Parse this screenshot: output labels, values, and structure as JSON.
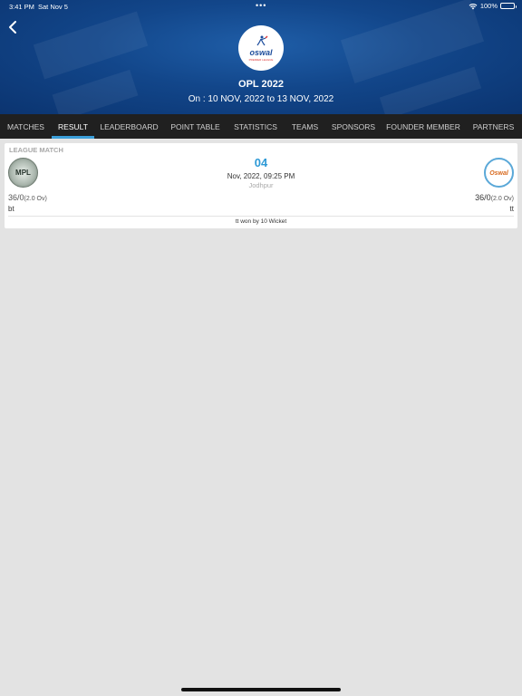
{
  "status_bar": {
    "time": "3:41 PM",
    "date": "Sat Nov 5",
    "dots": "•••",
    "battery": "100%"
  },
  "header": {
    "logo_text": "oswal",
    "logo_subtext": "PREMIER LEAGUE",
    "title": "OPL 2022",
    "dates": "On : 10 NOV, 2022 to 13 NOV, 2022"
  },
  "tabs": [
    {
      "label": "MATCHES",
      "active": false
    },
    {
      "label": "RESULT",
      "active": true
    },
    {
      "label": "LEADERBOARD",
      "active": false
    },
    {
      "label": "POINT TABLE",
      "active": false
    },
    {
      "label": "STATISTICS",
      "active": false
    },
    {
      "label": "TEAMS",
      "active": false
    },
    {
      "label": "SPONSORS",
      "active": false
    },
    {
      "label": "FOUNDER MEMBER",
      "active": false
    },
    {
      "label": "PARTNERS",
      "active": false
    }
  ],
  "match": {
    "type": "LEAGUE MATCH",
    "number": "04",
    "datetime": "Nov, 2022, 09:25  PM",
    "venue": "Jodhpur",
    "team_left": {
      "logo_text": "MPL",
      "score": "36/0",
      "overs": "(2.0 Ov)",
      "name": "bt"
    },
    "team_right": {
      "logo_text": "Oswal",
      "score": "36/0",
      "overs": "(2.0 Ov)",
      "name": "tt"
    },
    "result": "tt won by 10 Wicket"
  },
  "colors": {
    "header_bg": "#12468a",
    "tabbar_bg": "#202020",
    "tab_indicator": "#3b9ed8",
    "match_number": "#2e9ad6",
    "page_bg": "#e3e3e3"
  }
}
